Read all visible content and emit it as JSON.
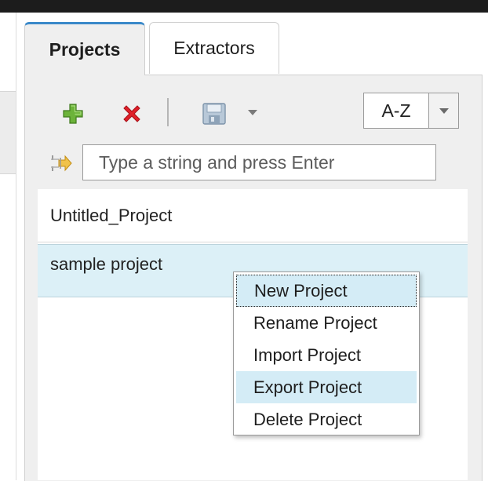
{
  "tabs": [
    {
      "label": "Projects",
      "active": true
    },
    {
      "label": "Extractors",
      "active": false
    }
  ],
  "toolbar": {
    "add_icon": "plus-icon",
    "delete_icon": "x-icon",
    "save_icon": "floppy-disk-icon",
    "save_menu_icon": "caret-down-icon"
  },
  "sort": {
    "value": "A-Z",
    "arrow_icon": "caret-down-icon"
  },
  "filter": {
    "placeholder": "Type a string and press Enter",
    "value": "",
    "icon": "filter-arrow-icon"
  },
  "projects": [
    {
      "name": "Untitled_Project",
      "selected": false
    },
    {
      "name": "sample project",
      "selected": true
    }
  ],
  "context_menu": {
    "items": [
      {
        "label": "New Project",
        "state": "focus"
      },
      {
        "label": "Rename Project",
        "state": ""
      },
      {
        "label": "Import Project",
        "state": ""
      },
      {
        "label": "Export Project",
        "state": "hover"
      },
      {
        "label": "Delete Project",
        "state": ""
      }
    ]
  },
  "colors": {
    "accent": "#3a89c9",
    "selection": "#dcf0f7",
    "menu_highlight": "#d4ecf6",
    "add_green": "#5aa02c",
    "delete_red": "#e0202a"
  }
}
